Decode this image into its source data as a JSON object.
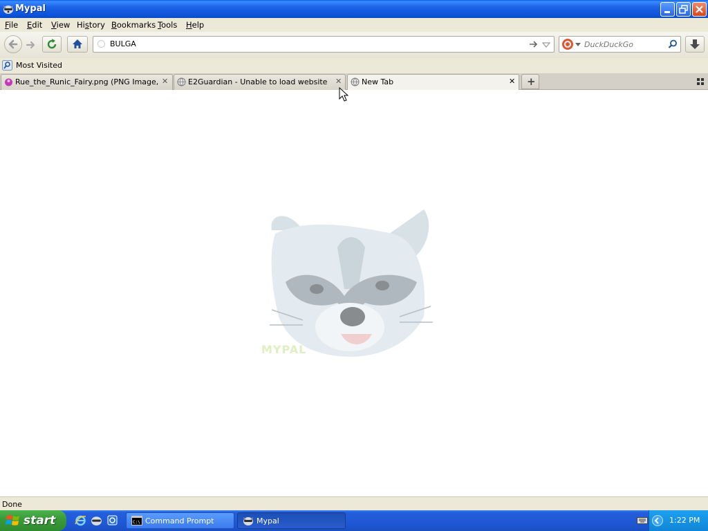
{
  "window": {
    "title": "Mypal",
    "minimize_label": "_",
    "maximize_label": "□",
    "close_label": "✕"
  },
  "menu": [
    "File",
    "Edit",
    "View",
    "History",
    "Bookmarks",
    "Tools",
    "Help"
  ],
  "menu_accel": [
    "F",
    "E",
    "V",
    "s",
    "B",
    "T",
    "H"
  ],
  "toolbar": {
    "url_value": "BULGA",
    "search_placeholder": "DuckDuckGo"
  },
  "bookmarks": {
    "most_visited": "Most Visited"
  },
  "tabs": [
    {
      "label": "Rue_the_Runic_Fairy.png (PNG Image, 1…",
      "close": "✕",
      "active": false
    },
    {
      "label": "E2Guardian - Unable to load website",
      "close": "✕",
      "active": false
    },
    {
      "label": "New Tab",
      "close": "✕",
      "active": true
    }
  ],
  "new_tab_label": "+",
  "logo_text": "MYPAL",
  "status": "Done",
  "taskbar": {
    "start": "start",
    "items": [
      {
        "label": "Command Prompt",
        "active": false
      },
      {
        "label": "Mypal",
        "active": true
      }
    ],
    "clock": "1:22 PM"
  },
  "colors": {
    "titlebar_blue": "#0c52d8",
    "taskbar_blue": "#245edb",
    "start_green": "#3a9b3a",
    "chrome_beige": "#ece9d8"
  }
}
